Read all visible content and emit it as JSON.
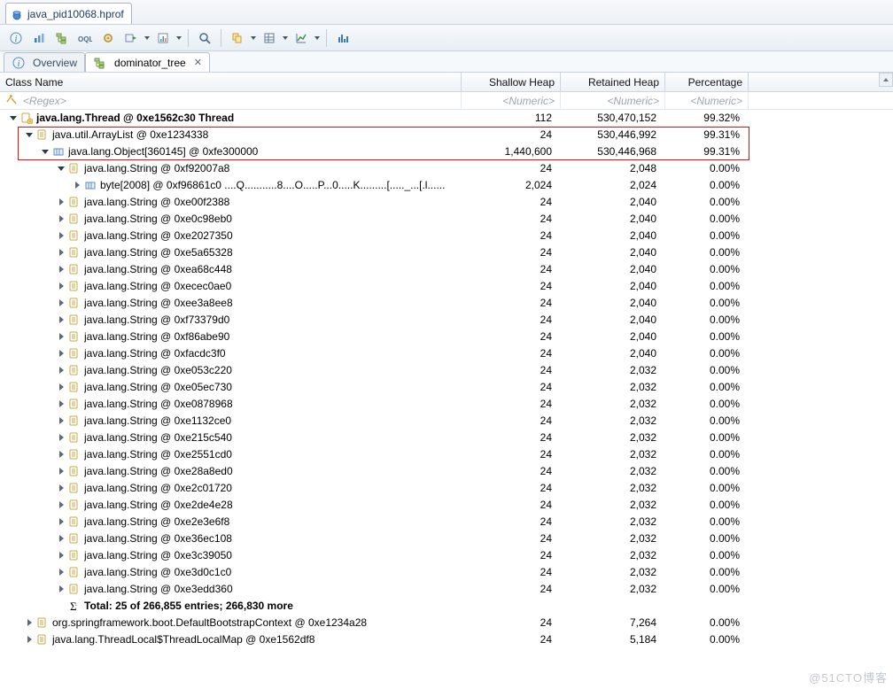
{
  "editor_tab": {
    "label": "java_pid10068.hprof"
  },
  "toolbar_icons": [
    {
      "name": "overview-icon",
      "glyph": "i"
    },
    {
      "name": "histogram-icon",
      "glyph": "bar"
    },
    {
      "name": "dominator-tree-icon",
      "glyph": "tree"
    },
    {
      "name": "oql-icon",
      "glyph": "oql"
    },
    {
      "name": "gear-icon",
      "glyph": "gear"
    },
    {
      "name": "run-icon",
      "glyph": "play",
      "dropdown": true
    },
    {
      "name": "stats-icon",
      "glyph": "stats",
      "dropdown": true
    },
    {
      "sep": true
    },
    {
      "name": "search-icon",
      "glyph": "search"
    },
    {
      "sep": true
    },
    {
      "name": "copy-icon",
      "glyph": "copy",
      "dropdown": true
    },
    {
      "name": "table-icon",
      "glyph": "table",
      "dropdown": true
    },
    {
      "name": "chart-icon",
      "glyph": "chart",
      "dropdown": true
    },
    {
      "sep": true
    },
    {
      "name": "histogram2-icon",
      "glyph": "bar2"
    }
  ],
  "view_tabs": [
    {
      "name": "overview",
      "label": "Overview",
      "active": false,
      "icon": "info"
    },
    {
      "name": "dominator",
      "label": "dominator_tree",
      "active": true,
      "icon": "tree",
      "closable": true
    }
  ],
  "columns": {
    "name": "Class Name",
    "shallow": "Shallow Heap",
    "retained": "Retained Heap",
    "pct": "Percentage"
  },
  "filters": {
    "name_label": "<Regex>",
    "numeric_label": "<Numeric>"
  },
  "rows": [
    {
      "depth": 0,
      "exp": "down",
      "icon": "thread",
      "text": "java.lang.Thread @ 0xe1562c30 ",
      "bold_suffix": "Thread",
      "shallow": "112",
      "retained": "530,470,152",
      "pct": "99.32%",
      "bold": true,
      "hl": false
    },
    {
      "depth": 1,
      "exp": "down",
      "icon": "class",
      "text": "java.util.ArrayList @ 0xe1234338",
      "shallow": "24",
      "retained": "530,446,992",
      "pct": "99.31%",
      "hl": true
    },
    {
      "depth": 2,
      "exp": "down",
      "icon": "array",
      "text": "java.lang.Object[360145] @ 0xfe300000",
      "shallow": "1,440,600",
      "retained": "530,446,968",
      "pct": "99.31%",
      "hl": true
    },
    {
      "depth": 3,
      "exp": "down",
      "icon": "class",
      "text": "java.lang.String @ 0xf92007a8",
      "shallow": "24",
      "retained": "2,048",
      "pct": "0.00%"
    },
    {
      "depth": 4,
      "exp": "right",
      "icon": "array",
      "text": "byte[2008] @ 0xf96861c0   ....Q...........8....O.....P...0.....K.........[....._...[.l......",
      "shallow": "2,024",
      "retained": "2,024",
      "pct": "0.00%"
    },
    {
      "depth": 3,
      "exp": "right",
      "icon": "class",
      "text": "java.lang.String @ 0xe00f2388",
      "shallow": "24",
      "retained": "2,040",
      "pct": "0.00%"
    },
    {
      "depth": 3,
      "exp": "right",
      "icon": "class",
      "text": "java.lang.String @ 0xe0c98eb0",
      "shallow": "24",
      "retained": "2,040",
      "pct": "0.00%"
    },
    {
      "depth": 3,
      "exp": "right",
      "icon": "class",
      "text": "java.lang.String @ 0xe2027350",
      "shallow": "24",
      "retained": "2,040",
      "pct": "0.00%"
    },
    {
      "depth": 3,
      "exp": "right",
      "icon": "class",
      "text": "java.lang.String @ 0xe5a65328",
      "shallow": "24",
      "retained": "2,040",
      "pct": "0.00%"
    },
    {
      "depth": 3,
      "exp": "right",
      "icon": "class",
      "text": "java.lang.String @ 0xea68c448",
      "shallow": "24",
      "retained": "2,040",
      "pct": "0.00%"
    },
    {
      "depth": 3,
      "exp": "right",
      "icon": "class",
      "text": "java.lang.String @ 0xecec0ae0",
      "shallow": "24",
      "retained": "2,040",
      "pct": "0.00%"
    },
    {
      "depth": 3,
      "exp": "right",
      "icon": "class",
      "text": "java.lang.String @ 0xee3a8ee8",
      "shallow": "24",
      "retained": "2,040",
      "pct": "0.00%"
    },
    {
      "depth": 3,
      "exp": "right",
      "icon": "class",
      "text": "java.lang.String @ 0xf73379d0",
      "shallow": "24",
      "retained": "2,040",
      "pct": "0.00%"
    },
    {
      "depth": 3,
      "exp": "right",
      "icon": "class",
      "text": "java.lang.String @ 0xf86abe90",
      "shallow": "24",
      "retained": "2,040",
      "pct": "0.00%"
    },
    {
      "depth": 3,
      "exp": "right",
      "icon": "class",
      "text": "java.lang.String @ 0xfacdc3f0",
      "shallow": "24",
      "retained": "2,040",
      "pct": "0.00%"
    },
    {
      "depth": 3,
      "exp": "right",
      "icon": "class",
      "text": "java.lang.String @ 0xe053c220",
      "shallow": "24",
      "retained": "2,032",
      "pct": "0.00%"
    },
    {
      "depth": 3,
      "exp": "right",
      "icon": "class",
      "text": "java.lang.String @ 0xe05ec730",
      "shallow": "24",
      "retained": "2,032",
      "pct": "0.00%"
    },
    {
      "depth": 3,
      "exp": "right",
      "icon": "class",
      "text": "java.lang.String @ 0xe0878968",
      "shallow": "24",
      "retained": "2,032",
      "pct": "0.00%"
    },
    {
      "depth": 3,
      "exp": "right",
      "icon": "class",
      "text": "java.lang.String @ 0xe1132ce0",
      "shallow": "24",
      "retained": "2,032",
      "pct": "0.00%"
    },
    {
      "depth": 3,
      "exp": "right",
      "icon": "class",
      "text": "java.lang.String @ 0xe215c540",
      "shallow": "24",
      "retained": "2,032",
      "pct": "0.00%"
    },
    {
      "depth": 3,
      "exp": "right",
      "icon": "class",
      "text": "java.lang.String @ 0xe2551cd0",
      "shallow": "24",
      "retained": "2,032",
      "pct": "0.00%"
    },
    {
      "depth": 3,
      "exp": "right",
      "icon": "class",
      "text": "java.lang.String @ 0xe28a8ed0",
      "shallow": "24",
      "retained": "2,032",
      "pct": "0.00%"
    },
    {
      "depth": 3,
      "exp": "right",
      "icon": "class",
      "text": "java.lang.String @ 0xe2c01720",
      "shallow": "24",
      "retained": "2,032",
      "pct": "0.00%"
    },
    {
      "depth": 3,
      "exp": "right",
      "icon": "class",
      "text": "java.lang.String @ 0xe2de4e28",
      "shallow": "24",
      "retained": "2,032",
      "pct": "0.00%"
    },
    {
      "depth": 3,
      "exp": "right",
      "icon": "class",
      "text": "java.lang.String @ 0xe2e3e6f8",
      "shallow": "24",
      "retained": "2,032",
      "pct": "0.00%"
    },
    {
      "depth": 3,
      "exp": "right",
      "icon": "class",
      "text": "java.lang.String @ 0xe36ec108",
      "shallow": "24",
      "retained": "2,032",
      "pct": "0.00%"
    },
    {
      "depth": 3,
      "exp": "right",
      "icon": "class",
      "text": "java.lang.String @ 0xe3c39050",
      "shallow": "24",
      "retained": "2,032",
      "pct": "0.00%"
    },
    {
      "depth": 3,
      "exp": "right",
      "icon": "class",
      "text": "java.lang.String @ 0xe3d0c1c0",
      "shallow": "24",
      "retained": "2,032",
      "pct": "0.00%"
    },
    {
      "depth": 3,
      "exp": "right",
      "icon": "class",
      "text": "java.lang.String @ 0xe3edd360",
      "shallow": "24",
      "retained": "2,032",
      "pct": "0.00%"
    },
    {
      "depth": 3,
      "exp": "none",
      "icon": "sum",
      "text": "Total: 25 of 266,855 entries; 266,830 more",
      "shallow": "",
      "retained": "",
      "pct": "",
      "bold": true
    },
    {
      "depth": 1,
      "exp": "right",
      "icon": "class",
      "text": "org.springframework.boot.DefaultBootstrapContext @ 0xe1234a28",
      "shallow": "24",
      "retained": "7,264",
      "pct": "0.00%"
    },
    {
      "depth": 1,
      "exp": "right",
      "icon": "class",
      "text": "java.lang.ThreadLocal$ThreadLocalMap @ 0xe1562df8",
      "shallow": "24",
      "retained": "5,184",
      "pct": "0.00%"
    }
  ],
  "watermark": "@51CTO博客"
}
